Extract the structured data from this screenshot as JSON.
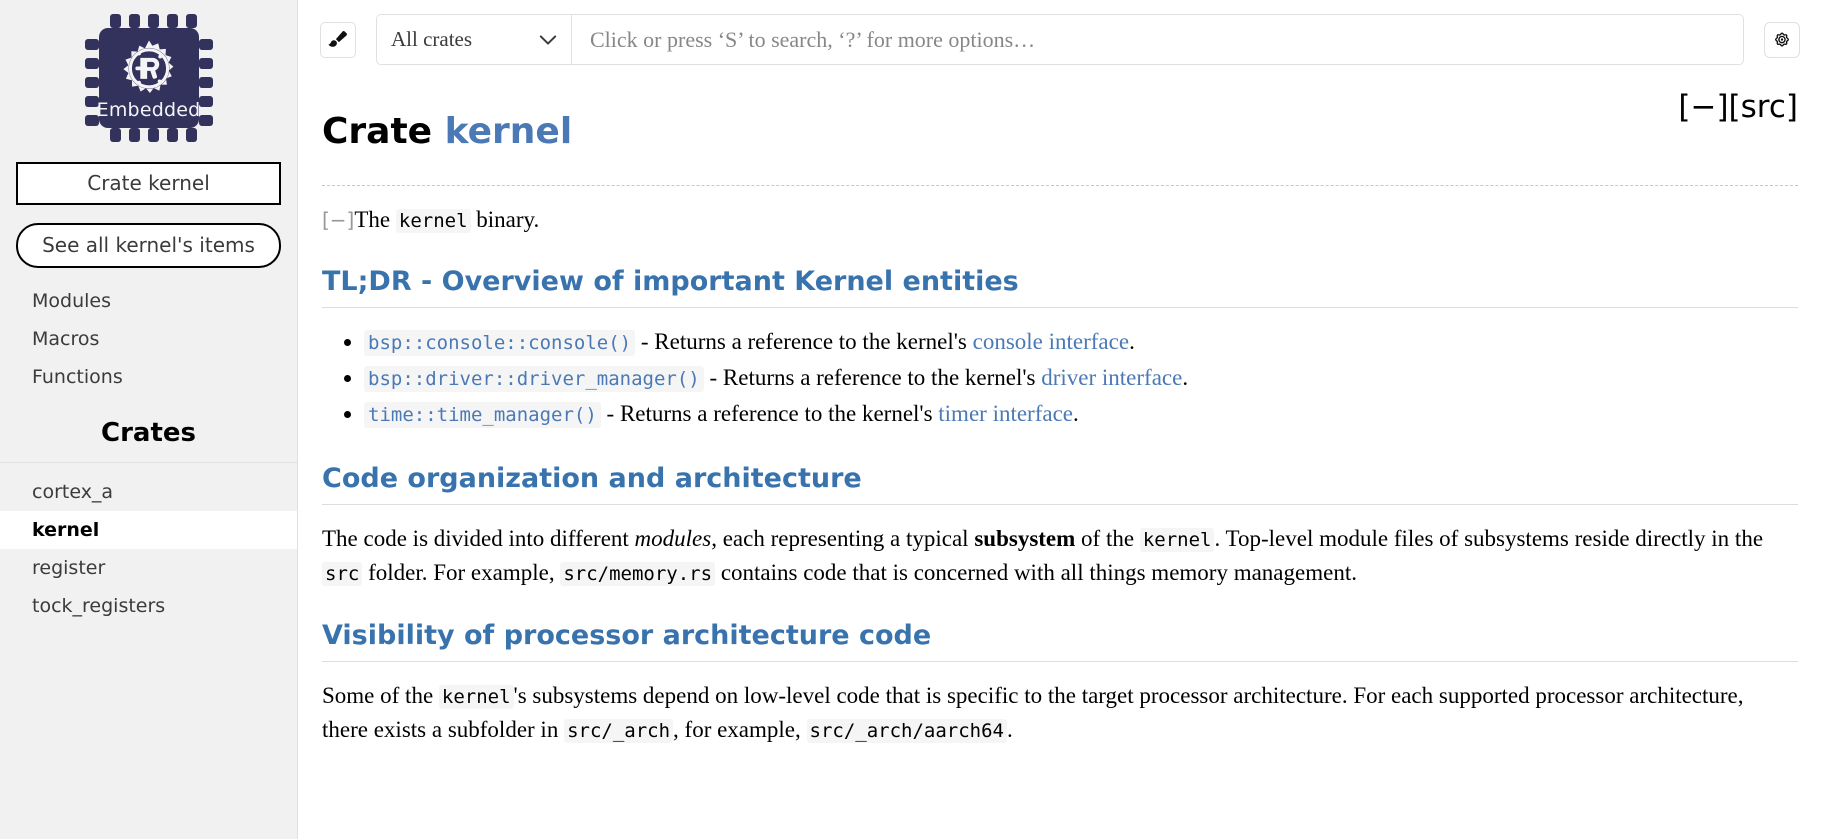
{
  "sidebar": {
    "logo": {
      "alt": "rust-embedded-logo",
      "label": "Embedded"
    },
    "crate_title": "Crate kernel",
    "see_all": "See all kernel's items",
    "nav_items": [
      {
        "label": "Modules",
        "name": "sidebar-link-modules"
      },
      {
        "label": "Macros",
        "name": "sidebar-link-macros"
      },
      {
        "label": "Functions",
        "name": "sidebar-link-functions"
      }
    ],
    "crates_heading": "Crates",
    "crates": [
      {
        "label": "cortex_a",
        "current": false
      },
      {
        "label": "kernel",
        "current": true
      },
      {
        "label": "register",
        "current": false
      },
      {
        "label": "tock_registers",
        "current": false
      }
    ]
  },
  "toolbar": {
    "theme_icon": "paintbrush-icon",
    "crate_filter": "All crates",
    "search_placeholder": "Click or press ‘S’ to search, ‘?’ for more options…",
    "search_value": "",
    "settings_icon": "gear-icon"
  },
  "page": {
    "title_prefix": "Crate",
    "title_crate": "kernel",
    "collapse_toggle": "[−]",
    "src_link": "[src]",
    "intro_toggle": "[−]",
    "intro_before": "The ",
    "intro_code": "kernel",
    "intro_after": " binary."
  },
  "sections": [
    {
      "heading": "TL;DR - Overview of important Kernel entities",
      "bullets": [
        {
          "code": "bsp::console::console()",
          "text_mid": " - Returns a reference to the kernel's ",
          "link": "console interface",
          "text_end": "."
        },
        {
          "code": "bsp::driver::driver_manager()",
          "text_mid": " - Returns a reference to the kernel's ",
          "link": "driver interface",
          "text_end": "."
        },
        {
          "code": "time::time_manager()",
          "text_mid": " - Returns a reference to the kernel's ",
          "link": "timer interface",
          "text_end": "."
        }
      ]
    },
    {
      "heading": "Code organization and architecture",
      "paragraph": {
        "p1": "The code is divided into different ",
        "em1": "modules",
        "p2": ", each representing a typical ",
        "strong1": "subsystem",
        "p3": " of the ",
        "code1": "kernel",
        "p4": ". Top-level module files of subsystems reside directly in the ",
        "code2": "src",
        "p5": " folder. For example, ",
        "code3": "src/memory.rs",
        "p6": " contains code that is concerned with all things memory management."
      }
    },
    {
      "heading": "Visibility of processor architecture code",
      "paragraph": {
        "p1": "Some of the ",
        "code1": "kernel",
        "p2": "'s subsystems depend on low-level code that is specific to the target processor architecture. For each supported processor architecture, there exists a subfolder in ",
        "code2": "src/_arch",
        "p3": ", for example, ",
        "code3": "src/_arch/aarch64",
        "p4": "."
      }
    }
  ],
  "colors": {
    "link": "#4a79b5",
    "heading": "#3873ad",
    "logo_bg": "#32325d",
    "sidebar_bg": "#f1f1f1"
  }
}
